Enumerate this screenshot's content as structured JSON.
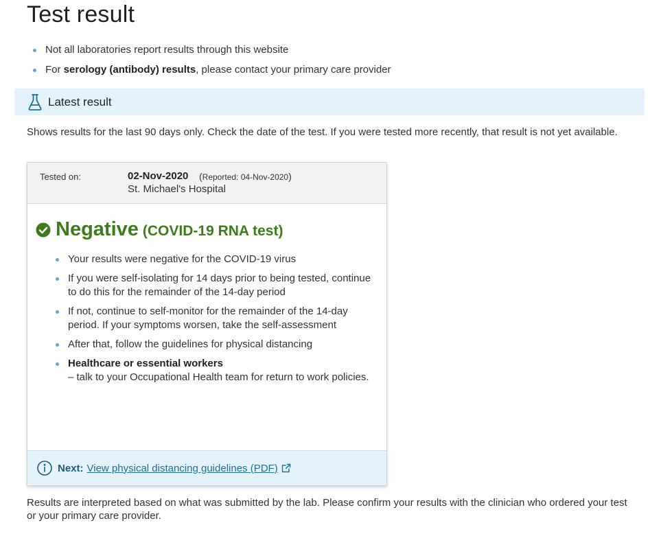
{
  "page": {
    "title": "Test result",
    "notes": [
      {
        "pre": "Not all laboratories report results through this website",
        "bold": "",
        "post": ""
      },
      {
        "pre": "For ",
        "bold": "serology (antibody) results",
        "post": ", please contact your primary care provider"
      }
    ]
  },
  "section": {
    "icon": "flask-icon",
    "title": "Latest result",
    "intro": "Shows results for the last 90 days only. Check the date of the test. If you were tested more recently, that result is not yet available."
  },
  "result_card": {
    "tested_label": "Tested on:",
    "tested_date": "02-Nov-2020",
    "reported_label": "Reported: ",
    "reported_date": "04-Nov-2020",
    "location": "St. Michael's Hospital",
    "status_icon": "check-circle-icon",
    "status": "Negative",
    "test_name": "(COVID-19 RNA test)",
    "status_color": "#3d7b1d",
    "guidance": [
      {
        "bold": "",
        "text": "Your results were negative for the COVID-19 virus"
      },
      {
        "bold": "",
        "text": "If you were self-isolating for 14 days prior to being tested, continue to do this for the remainder of the 14-day period"
      },
      {
        "bold": "",
        "text": "If not, continue to self-monitor for the remainder of the 14-day period. If your symptoms worsen, take the self-assessment"
      },
      {
        "bold": "",
        "text": "After that, follow the guidelines for physical distancing"
      },
      {
        "bold": "Healthcare or essential workers",
        "text": "– talk to your Occupational Health team for return to work policies."
      }
    ],
    "next_icon": "info-circle-icon",
    "next_label": "Next:",
    "next_link": "View physical distancing guidelines (PDF)",
    "external_icon": "external-link-icon"
  },
  "footer": {
    "text": "Results are interpreted based on what was submitted by the lab. Please confirm your results with the clinician who ordered your test or your primary care provider."
  },
  "colors": {
    "accent_bg": "#e4f3fb",
    "bullet": "#6aa6c8",
    "link": "#1f6f98",
    "success": "#3d7b1d"
  }
}
